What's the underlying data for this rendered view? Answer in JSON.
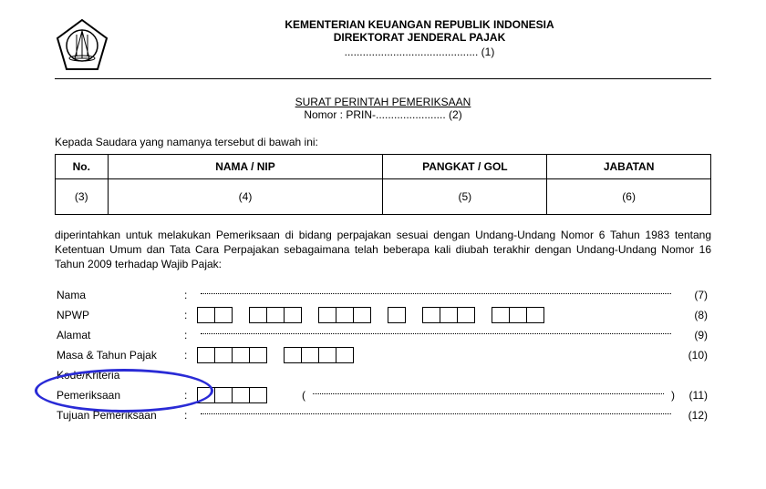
{
  "header": {
    "line1": "KEMENTERIAN KEUANGAN REPUBLIK INDONESIA",
    "line2": "DIREKTORAT JENDERAL PAJAK",
    "line3_dots": "............................................",
    "line3_num": " (1)"
  },
  "title": {
    "main": "SURAT PERINTAH PEMERIKSAAN",
    "nomor_label": "Nomor : PRIN-",
    "nomor_dots": ".......................",
    "nomor_num": " (2)"
  },
  "intro": "Kepada Saudara yang namanya tersebut di bawah ini:",
  "table": {
    "headers": [
      "No.",
      "NAMA / NIP",
      "PANGKAT / GOL",
      "JABATAN"
    ],
    "row": [
      "(3)",
      "(4)",
      "(5)",
      "(6)"
    ]
  },
  "para": "diperintahkan untuk melakukan Pemeriksaan di bidang perpajakan sesuai dengan Undang-Undang Nomor 6 Tahun 1983 tentang Ketentuan Umum dan Tata Cara Perpajakan sebagaimana telah beberapa kali diubah terakhir dengan Undang-Undang Nomor 16 Tahun 2009 terhadap Wajib Pajak:",
  "fields": {
    "nama": {
      "label": "Nama",
      "num": "(7)"
    },
    "npwp": {
      "label": "NPWP",
      "num": "(8)"
    },
    "alamat": {
      "label": "Alamat",
      "num": "(9)"
    },
    "masa": {
      "label": "Masa & Tahun Pajak",
      "num": "(10)"
    },
    "kode1": {
      "label": "Kode/Kriteria"
    },
    "kode2": {
      "label": "Pemeriksaan",
      "num": "(11)"
    },
    "tujuan": {
      "label": "Tujuan Pemeriksaan",
      "num": "(12)"
    }
  }
}
